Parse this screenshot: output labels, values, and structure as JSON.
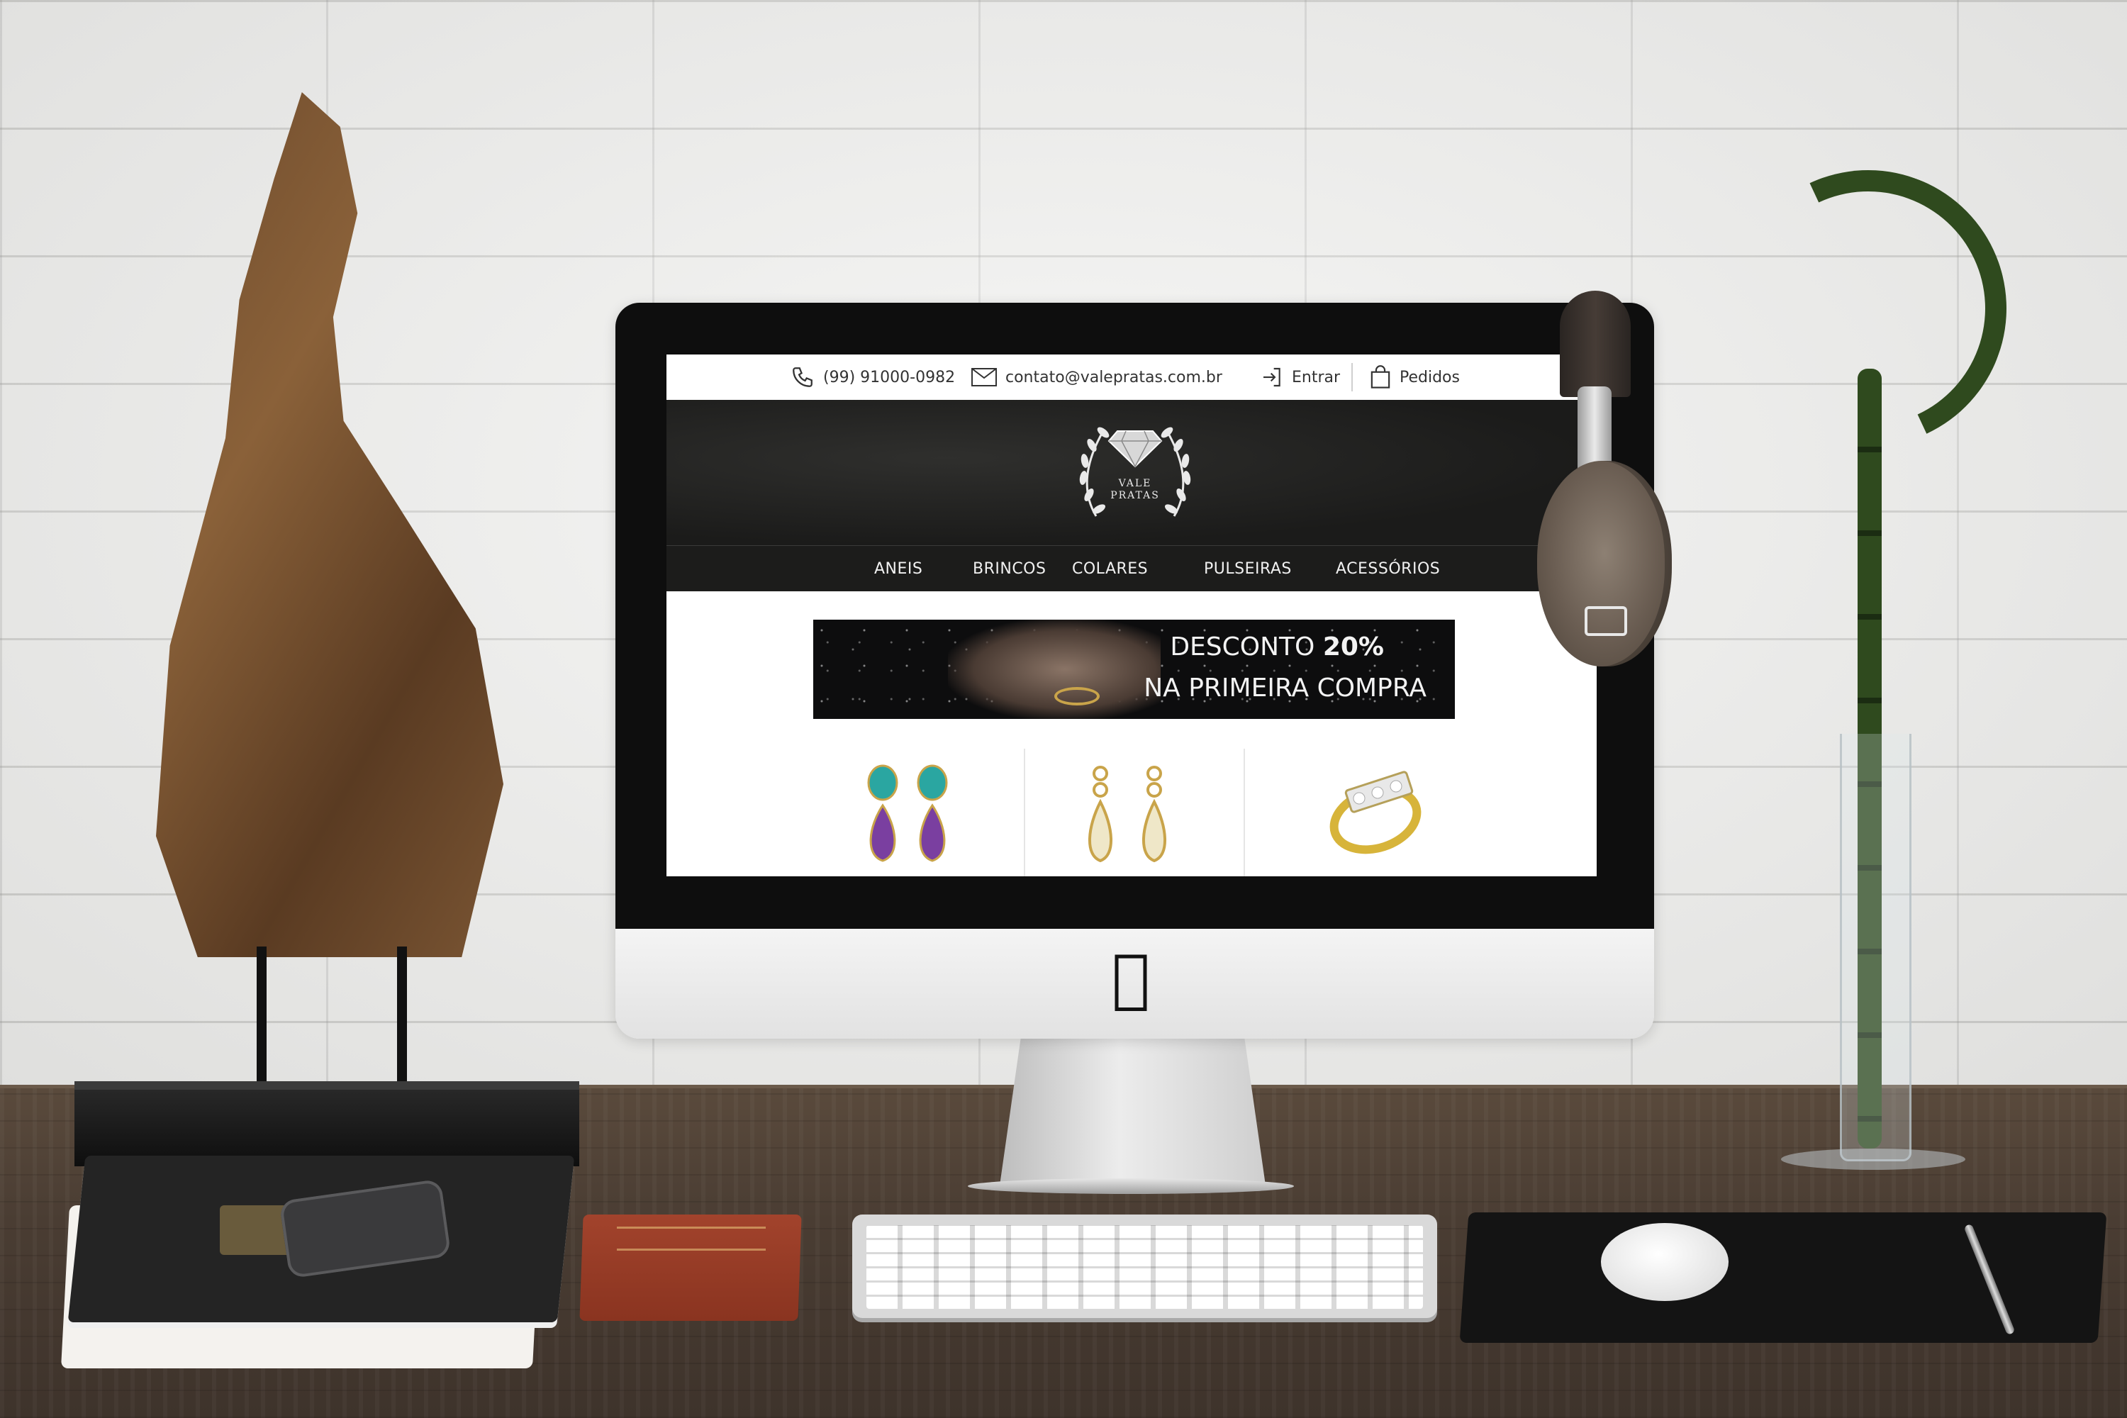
{
  "website": {
    "topbar": {
      "phone": "(99) 91000-0982",
      "email": "contato@valepratas.com.br",
      "login_label": "Entrar",
      "orders_label": "Pedidos"
    },
    "logo": {
      "line1": "VALE",
      "line2": "PRATAS"
    },
    "nav": {
      "items": [
        "ANEIS",
        "BRINCOS",
        "COLARES",
        "PULSEIRAS",
        "ACESSÓRIOS"
      ]
    },
    "banner": {
      "line1_prefix": "DESCONTO ",
      "line1_highlight": "20%",
      "line2": "NA PRIMEIRA COMPRA"
    },
    "products": [
      {
        "icon": "amethyst-turquoise-earrings-icon"
      },
      {
        "icon": "gold-crystal-drop-earrings-icon"
      },
      {
        "icon": "gold-diamond-ring-icon"
      }
    ]
  },
  "colors": {
    "header_bg": "#1c1c1b",
    "accent_gold": "#c9a44a",
    "amethyst": "#7a3fa0",
    "turquoise": "#2aa6a1"
  }
}
